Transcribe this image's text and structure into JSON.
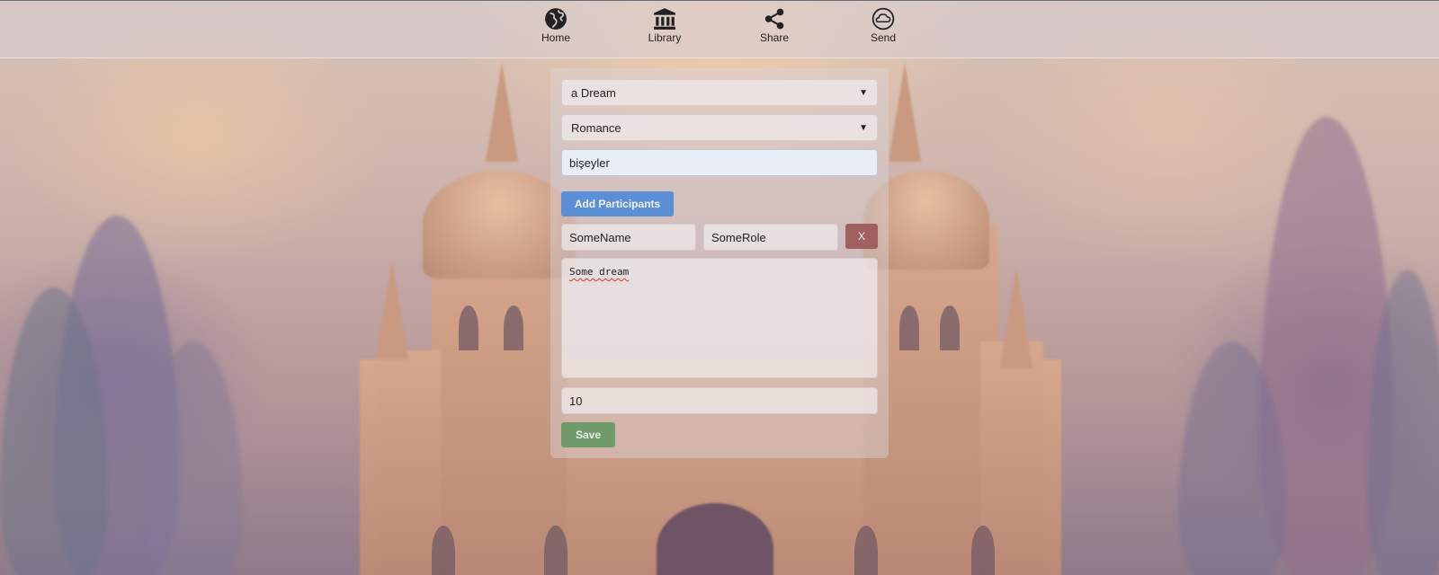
{
  "nav": {
    "items": [
      {
        "label": "Home",
        "icon": "globe-icon"
      },
      {
        "label": "Library",
        "icon": "library-icon"
      },
      {
        "label": "Share",
        "icon": "share-icon"
      },
      {
        "label": "Send",
        "icon": "send-icon"
      }
    ]
  },
  "form": {
    "type_select": "a Dream",
    "genre_select": "Romance",
    "title_input": "bişeyler",
    "add_participants_label": "Add Participants",
    "participant": {
      "name": "SomeName",
      "role": "SomeRole",
      "remove_label": "X"
    },
    "content": "Some dream",
    "number_input": "10",
    "save_label": "Save"
  },
  "colors": {
    "add_button": "#5b8fd6",
    "remove_button": "#a06060",
    "save_button": "#6f9a6a"
  }
}
